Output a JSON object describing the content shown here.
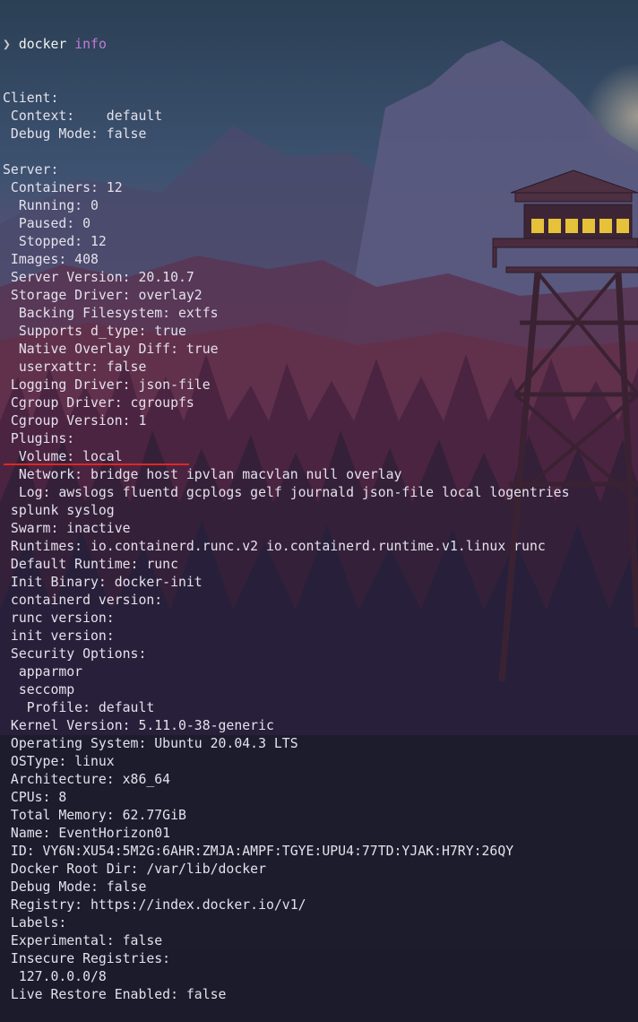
{
  "prompt": {
    "symbol": "❯",
    "command": "docker",
    "argument": "info"
  },
  "output_lines": [
    "Client:",
    " Context:    default",
    " Debug Mode: false",
    "",
    "Server:",
    " Containers: 12",
    "  Running: 0",
    "  Paused: 0",
    "  Stopped: 12",
    " Images: 408",
    " Server Version: 20.10.7",
    " Storage Driver: overlay2",
    "  Backing Filesystem: extfs",
    "  Supports d_type: true",
    "  Native Overlay Diff: true",
    "  userxattr: false",
    " Logging Driver: json-file",
    " Cgroup Driver: cgroupfs",
    " Cgroup Version: 1",
    " Plugins:",
    "  Volume: local",
    "  Network: bridge host ipvlan macvlan null overlay",
    "  Log: awslogs fluentd gcplogs gelf journald json-file local logentries",
    " splunk syslog",
    " Swarm: inactive",
    " Runtimes: io.containerd.runc.v2 io.containerd.runtime.v1.linux runc",
    " Default Runtime: runc",
    " Init Binary: docker-init",
    " containerd version:",
    " runc version:",
    " init version:",
    " Security Options:",
    "  apparmor",
    "  seccomp",
    "   Profile: default",
    " Kernel Version: 5.11.0-38-generic",
    " Operating System: Ubuntu 20.04.3 LTS",
    " OSType: linux",
    " Architecture: x86_64",
    " CPUs: 8",
    " Total Memory: 62.77GiB",
    " Name: EventHorizon01",
    " ID: VY6N:XU54:5M2G:6AHR:ZMJA:AMPF:TGYE:UPU4:77TD:YJAK:H7RY:26QY",
    " Docker Root Dir: /var/lib/docker",
    " Debug Mode: false",
    " Registry: https://index.docker.io/v1/",
    " Labels:",
    " Experimental: false",
    " Insecure Registries:",
    "  127.0.0.0/8",
    " Live Restore Enabled: false"
  ],
  "colors": {
    "text": "#e4e1ec",
    "argument": "#c57bd6",
    "highlight_underline": "#e3261f",
    "background": "#1c1b2b"
  }
}
